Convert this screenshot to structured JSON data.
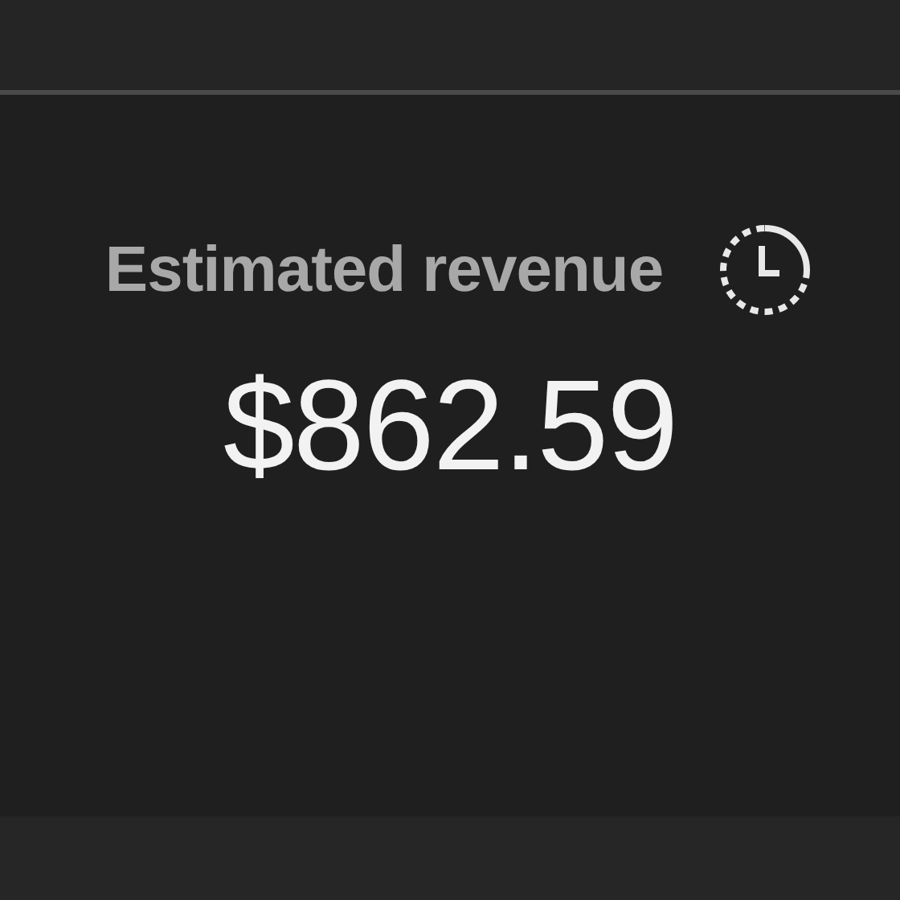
{
  "card": {
    "title": "Estimated revenue",
    "value": "$862.59"
  }
}
